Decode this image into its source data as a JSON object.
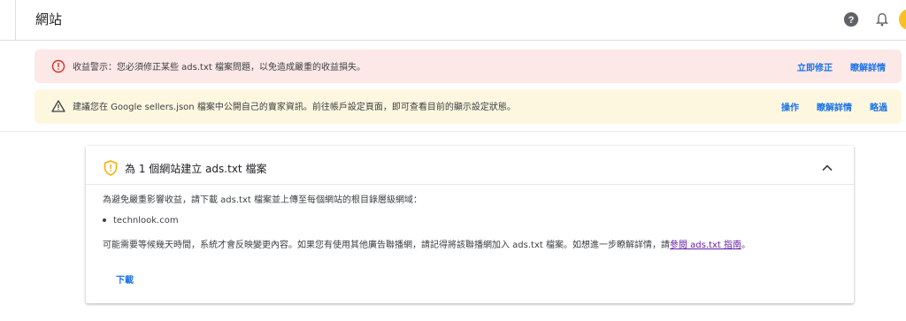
{
  "header": {
    "title": "網站",
    "icons": {
      "help": "help-circle-icon",
      "notifications": "bell-icon",
      "account": "avatar"
    },
    "colors": {
      "avatar": "#f6c026"
    }
  },
  "alerts": {
    "error": {
      "icon": "error-circle-icon",
      "message": "收益警示：您必須修正某些 ads.txt 檔案問題，以免造成嚴重的收益損失。",
      "fix_now": "立即修正",
      "learn_more": "瞭解詳情",
      "color": "#fce8e6"
    },
    "warning": {
      "icon": "warning-triangle-icon",
      "message": "建議您在 Google sellers.json 檔案中公開自己的賣家資訊。前往帳戶設定頁面，即可查看目前的顯示設定狀態。",
      "action": "操作",
      "learn_more": "瞭解詳情",
      "dismiss": "略過",
      "color": "#fef7e0"
    }
  },
  "card": {
    "icon": "shield-warning-icon",
    "title": "為 1 個網站建立 ads.txt 檔案",
    "intro": "為避免嚴重影響收益，請下載 ads.txt 檔案並上傳至每個網站的根目錄層級網域：",
    "sites": [
      "technlook.com"
    ],
    "note_prefix": "可能需要等候幾天時間，系統才會反映變更內容。如果您有使用其他廣告聯播網，請記得將該聯播網加入 ads.txt 檔案。如想進一步瞭解詳情，請",
    "guide_link": "參閱 ads.txt 指南",
    "note_suffix": "。",
    "download": "下載"
  },
  "colors": {
    "link": "#1a73e8",
    "visited_link": "#681da8",
    "shield": "#f9ab00"
  }
}
